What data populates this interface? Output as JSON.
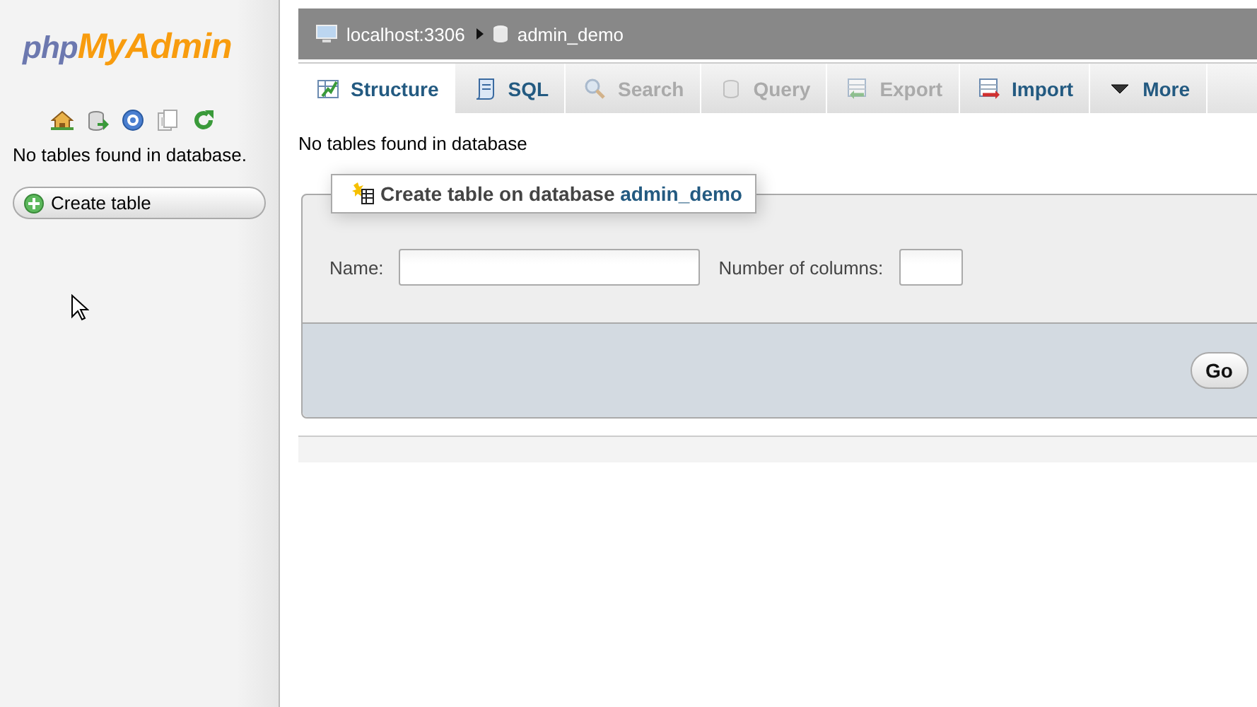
{
  "logo": {
    "prefix": "php",
    "name": "MyAdmin"
  },
  "sidebar": {
    "message": "No tables found in database.",
    "create_button": "Create table"
  },
  "breadcrumb": [
    {
      "label": "localhost:3306"
    },
    {
      "label": "admin_demo"
    }
  ],
  "tabs": [
    {
      "label": "Structure",
      "selected": true,
      "disabled": false
    },
    {
      "label": "SQL",
      "selected": false,
      "disabled": false
    },
    {
      "label": "Search",
      "selected": false,
      "disabled": true
    },
    {
      "label": "Query",
      "selected": false,
      "disabled": true
    },
    {
      "label": "Export",
      "selected": false,
      "disabled": true
    },
    {
      "label": "Import",
      "selected": false,
      "disabled": false
    },
    {
      "label": "More",
      "selected": false,
      "disabled": false
    }
  ],
  "message": "No tables found in database",
  "create_form": {
    "legend": "Create table on database",
    "database": "admin_demo",
    "name_label": "Name:",
    "columns_label": "Number of columns:",
    "go_button": "Go"
  }
}
